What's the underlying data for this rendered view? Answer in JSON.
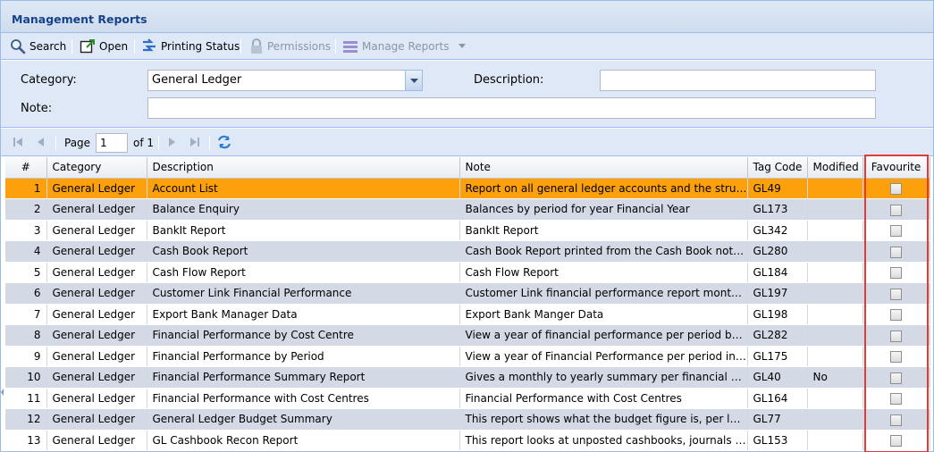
{
  "panel": {
    "title": "Management Reports"
  },
  "toolbar": {
    "search": "Search",
    "open": "Open",
    "printing_status": "Printing Status",
    "permissions": "Permissions",
    "manage_reports": "Manage Reports"
  },
  "form": {
    "category_label": "Category:",
    "category_value": "General Ledger",
    "description_label": "Description:",
    "description_value": "",
    "note_label": "Note:",
    "note_value": ""
  },
  "pager": {
    "page_label": "Page",
    "page_value": "1",
    "of_label": "of 1"
  },
  "columns": {
    "num": "#",
    "category": "Category",
    "description": "Description",
    "note": "Note",
    "tag": "Tag Code",
    "modified": "Modified",
    "favourite": "Favourite"
  },
  "rows": [
    {
      "num": "1",
      "category": "General Ledger",
      "description": "Account List",
      "note": "Report on all general ledger accounts and the structure of the accounts",
      "tag": "GL49",
      "modified": "",
      "selected": true
    },
    {
      "num": "2",
      "category": "General Ledger",
      "description": "Balance Enquiry",
      "note": "Balances by period for year Financial Year",
      "tag": "GL173",
      "modified": ""
    },
    {
      "num": "3",
      "category": "General Ledger",
      "description": "BankIt Report",
      "note": "BankIt Report",
      "tag": "GL342",
      "modified": ""
    },
    {
      "num": "4",
      "category": "General Ledger",
      "description": "Cash Book Report",
      "note": "Cash Book Report printed from the Cash Book not from the ledger",
      "tag": "GL280",
      "modified": ""
    },
    {
      "num": "5",
      "category": "General Ledger",
      "description": "Cash Flow Report",
      "note": "Cash Flow Report",
      "tag": "GL184",
      "modified": ""
    },
    {
      "num": "6",
      "category": "General Ledger",
      "description": "Customer Link Financial Performance",
      "note": "Customer Link financial performance report monthly",
      "tag": "GL197",
      "modified": ""
    },
    {
      "num": "7",
      "category": "General Ledger",
      "description": "Export Bank Manager Data",
      "note": "Export Bank Manger Data",
      "tag": "GL198",
      "modified": ""
    },
    {
      "num": "8",
      "category": "General Ledger",
      "description": "Financial Performance by Cost Centre",
      "note": "View a year of financial performance per period by cost centre",
      "tag": "GL282",
      "modified": ""
    },
    {
      "num": "9",
      "category": "General Ledger",
      "description": "Financial Performance by Period",
      "note": "View a year of Financial Performance per period in one report",
      "tag": "GL175",
      "modified": ""
    },
    {
      "num": "10",
      "category": "General Ledger",
      "description": "Financial Performance Summary Report",
      "note": "Gives a monthly to yearly summary per financial period",
      "tag": "GL40",
      "modified": "No"
    },
    {
      "num": "11",
      "category": "General Ledger",
      "description": "Financial Performance with Cost Centres",
      "note": "Financial Performance with Cost Centres",
      "tag": "GL164",
      "modified": ""
    },
    {
      "num": "12",
      "category": "General Ledger",
      "description": "General Ledger Budget Summary",
      "note": "This report shows what the budget figure is, per ledger account",
      "tag": "GL77",
      "modified": ""
    },
    {
      "num": "13",
      "category": "General Ledger",
      "description": "GL Cashbook Recon Report",
      "note": "This report looks at unposted cashbooks, journals and receipts",
      "tag": "GL153",
      "modified": ""
    }
  ]
}
